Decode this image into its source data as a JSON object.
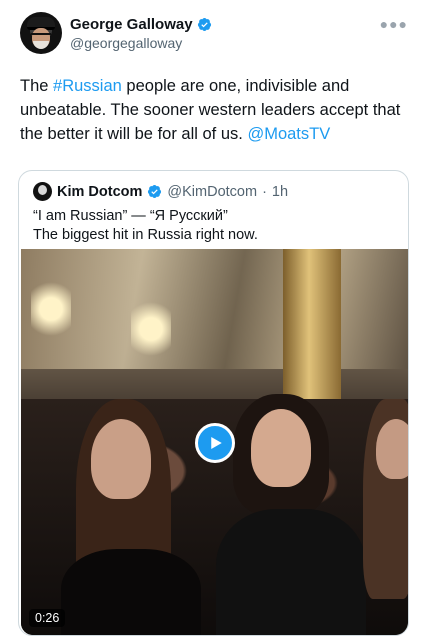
{
  "author": {
    "display_name": "George Galloway",
    "handle": "@georgegalloway",
    "verified": true,
    "avatar_icon": "profile-photo"
  },
  "more_icon": "ellipsis-icon",
  "tweet": {
    "text_before_hashtag": "The ",
    "hashtag": "#Russian",
    "text_after_hashtag": " people are one, indivisible and unbeatable. The sooner western leaders accept that the better it will be for all of us. ",
    "mention": "@MoatsTV"
  },
  "quoted": {
    "display_name": "Kim Dotcom",
    "handle": "@KimDotcom",
    "separator": "·",
    "time": "1h",
    "line1": "“I am Russian” — “Я Русский”",
    "line2": "The biggest hit in Russia right now.",
    "video": {
      "duration": "0:26",
      "play_icon": "play-icon"
    }
  },
  "colors": {
    "link": "#1d9bf0",
    "verified_badge": "#1d9bf0",
    "text": "#0f1419",
    "secondary_text": "#536471",
    "border": "#cfd9de"
  }
}
